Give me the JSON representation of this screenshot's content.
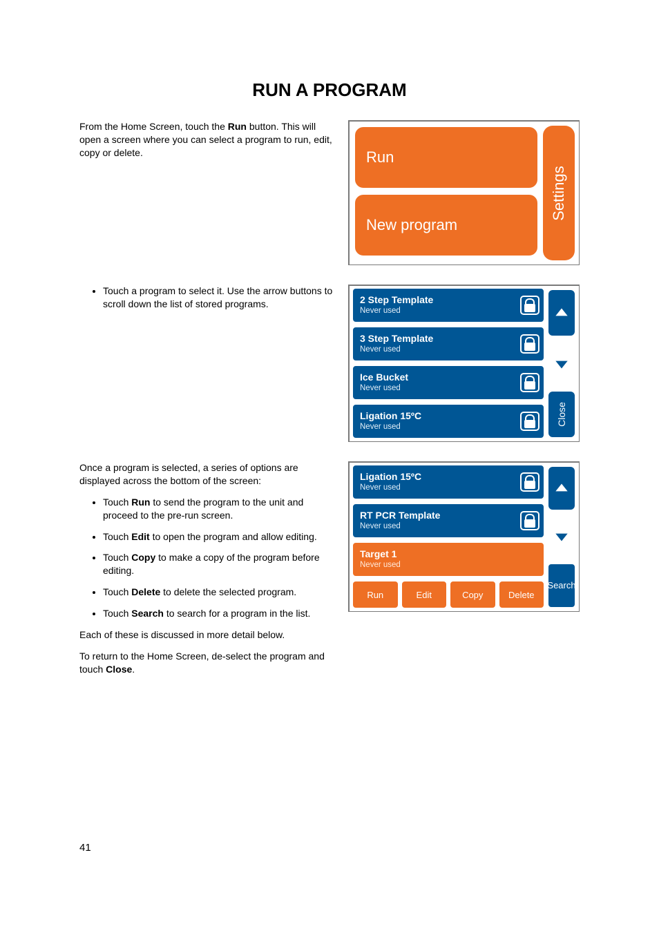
{
  "title": "RUN A PROGRAM",
  "page_number": "41",
  "intro": {
    "t1a": "From the Home Screen, touch the ",
    "t1b": "Run",
    "t1c": " button. This will open a screen where you can select a program to run, edit, copy or delete."
  },
  "bullet1": "Touch a program to select it. Use the arrow buttons to scroll down the list of stored programs.",
  "body2": "Once a program is selected, a series of options are displayed across the bottom of the screen:",
  "options": {
    "run_a": "Touch ",
    "run_b": "Run",
    "run_c": " to send the program to the unit and proceed to the pre-run screen.",
    "edit_a": "Touch ",
    "edit_b": "Edit",
    "edit_c": " to open the program and allow editing.",
    "copy_a": "Touch ",
    "copy_b": "Copy",
    "copy_c": " to make a copy of the program before editing.",
    "del_a": "Touch ",
    "del_b": "Delete",
    "del_c": " to delete the selected program.",
    "srch_a": "Touch ",
    "srch_b": "Search",
    "srch_c": " to search for a program in the list."
  },
  "trailer1": "Each of these is discussed in more detail below.",
  "trailer2a": "To return to the Home Screen, de-select the program and touch ",
  "trailer2b": "Close",
  "trailer2c": ".",
  "home": {
    "run": "Run",
    "new_program": "New program",
    "settings": "Settings"
  },
  "list1": {
    "items": [
      {
        "name": "2 Step Template",
        "status": "Never used"
      },
      {
        "name": "3 Step Template",
        "status": "Never used"
      },
      {
        "name": "Ice Bucket",
        "status": "Never used"
      },
      {
        "name": "Ligation 15ºC",
        "status": "Never used"
      }
    ],
    "close": "Close"
  },
  "list2": {
    "items": [
      {
        "name": "Ligation 15ºC",
        "status": "Never used"
      },
      {
        "name": "RT PCR Template",
        "status": "Never used"
      },
      {
        "name": "Target 1",
        "status": "Never used"
      }
    ],
    "toolbar": {
      "run": "Run",
      "edit": "Edit",
      "copy": "Copy",
      "delete": "Delete",
      "search": "Search"
    }
  }
}
